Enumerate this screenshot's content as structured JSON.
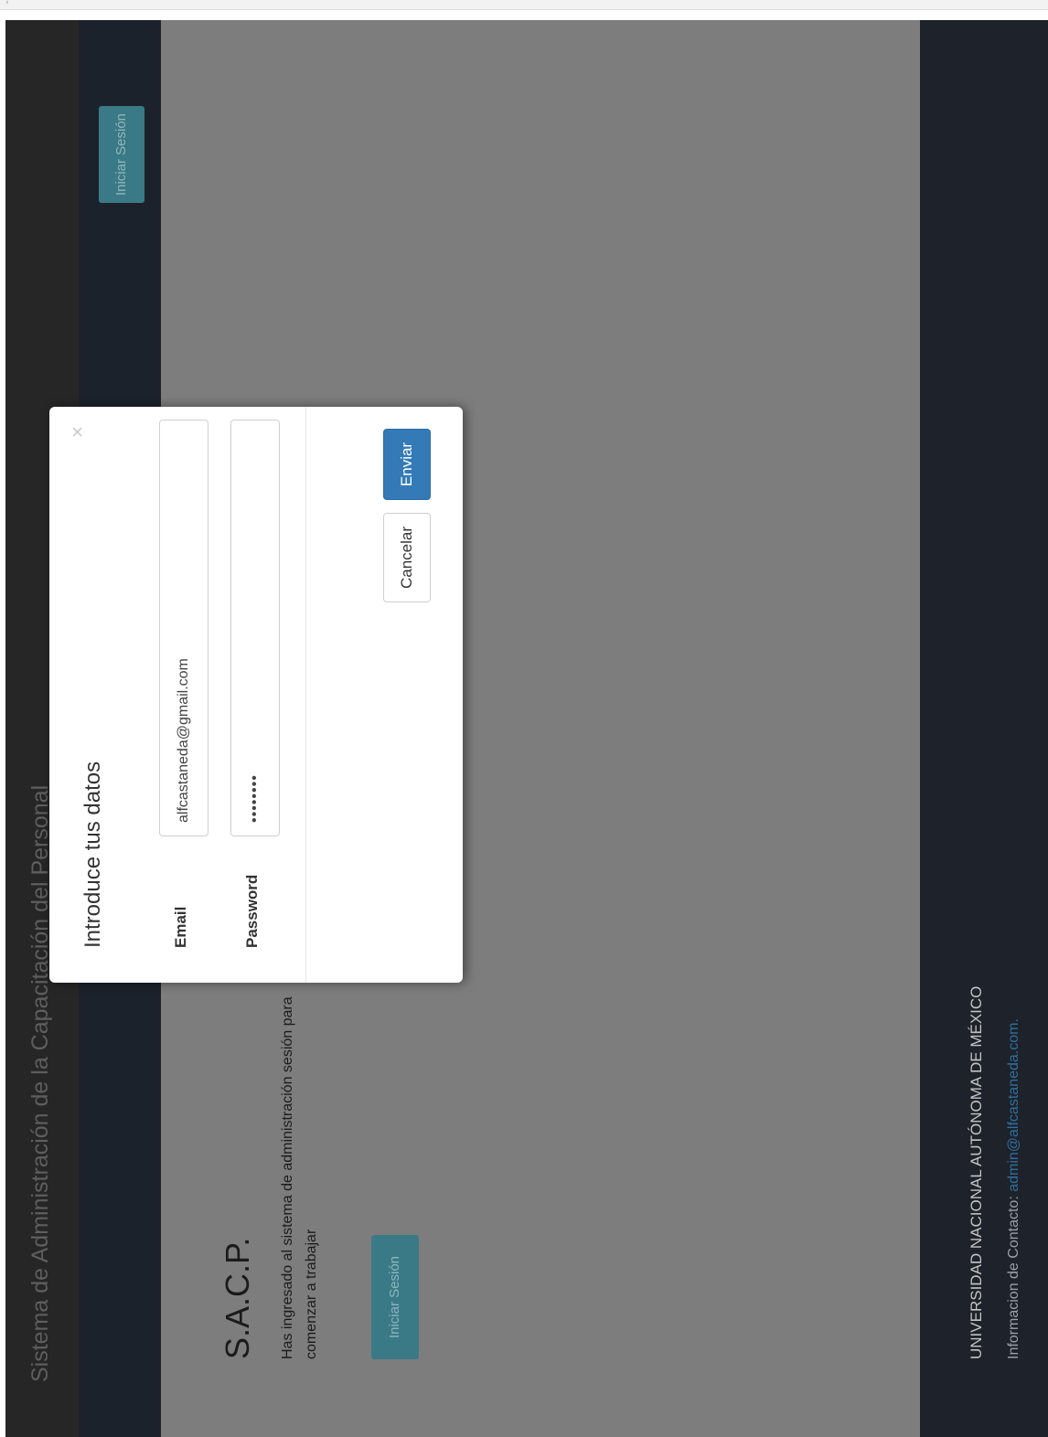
{
  "browser": {
    "corner_mark": "‹"
  },
  "navbar": {
    "brand": "Sistema de Administración de la Capacitación del Personal",
    "login_button": "Iniciar Sesión"
  },
  "hero": {
    "title": "S.A.C.P.",
    "text": "Has ingresado al sistema de administración sesión para comenzar a trabajar",
    "login_button": "Iniciar Sesión"
  },
  "footer": {
    "university": "UNIVERSIDAD NACIONAL AUTÓNOMA DE MÉXICO",
    "contact_label": "Informacion de Contacto:",
    "contact_email": "admin@alfcastaneda.com."
  },
  "modal": {
    "title": "Introduce tus datos",
    "close_glyph": "×",
    "email_label": "Email",
    "email_value": "alfcastaneda@gmail.com",
    "password_label": "Password",
    "password_value": "••••••••",
    "cancel_label": "Cancelar",
    "submit_label": "Enviar"
  },
  "colors": {
    "navbar_bg": "#262626",
    "hero_bg": "#7d7d7d",
    "footer_bg": "#1e222a",
    "primary_button": "#337ab7",
    "dimmed_button": "#3a7a86"
  }
}
